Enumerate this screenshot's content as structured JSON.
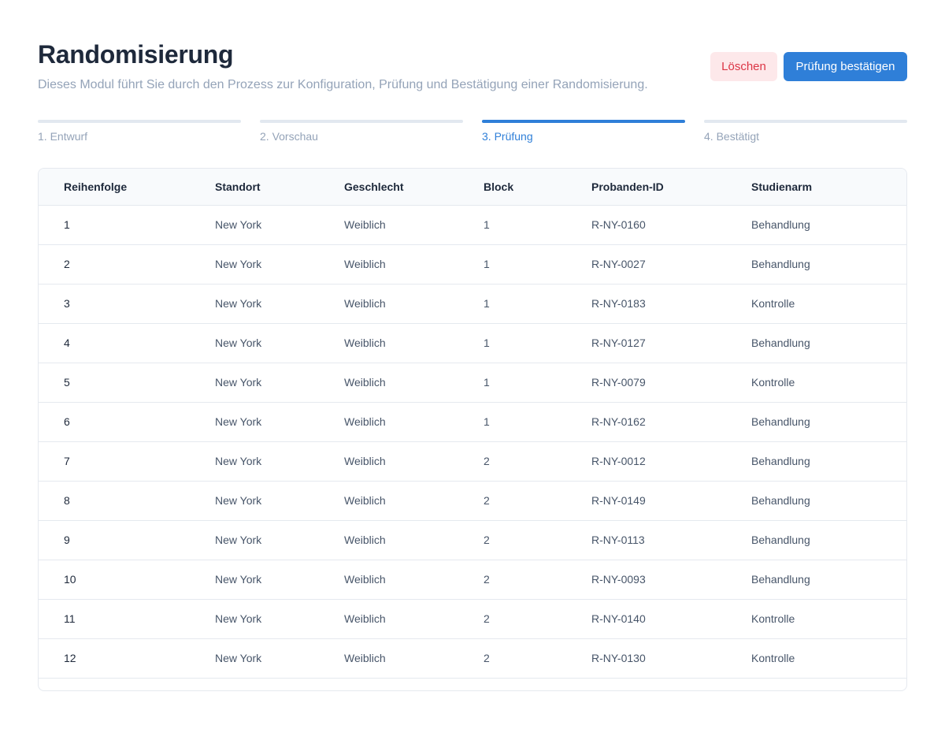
{
  "header": {
    "title": "Randomisierung",
    "subtitle": "Dieses Modul führt Sie durch den Prozess zur Konfiguration, Prüfung und Bestätigung einer Randomisierung."
  },
  "actions": {
    "delete_label": "Löschen",
    "confirm_label": "Prüfung bestätigen"
  },
  "colors": {
    "primary": "#2f7fd8",
    "danger": "#dc3545",
    "danger_bg": "#fde8ea"
  },
  "steps": [
    {
      "label": "1. Entwurf"
    },
    {
      "label": "2. Vorschau"
    },
    {
      "label": "3. Prüfung"
    },
    {
      "label": "4. Bestätigt"
    }
  ],
  "active_step": 3,
  "table": {
    "columns": [
      "Reihenfolge",
      "Standort",
      "Geschlecht",
      "Block",
      "Probanden-ID",
      "Studienarm"
    ],
    "rows": [
      [
        "1",
        "New York",
        "Weiblich",
        "1",
        "R-NY-0160",
        "Behandlung"
      ],
      [
        "2",
        "New York",
        "Weiblich",
        "1",
        "R-NY-0027",
        "Behandlung"
      ],
      [
        "3",
        "New York",
        "Weiblich",
        "1",
        "R-NY-0183",
        "Kontrolle"
      ],
      [
        "4",
        "New York",
        "Weiblich",
        "1",
        "R-NY-0127",
        "Behandlung"
      ],
      [
        "5",
        "New York",
        "Weiblich",
        "1",
        "R-NY-0079",
        "Kontrolle"
      ],
      [
        "6",
        "New York",
        "Weiblich",
        "1",
        "R-NY-0162",
        "Behandlung"
      ],
      [
        "7",
        "New York",
        "Weiblich",
        "2",
        "R-NY-0012",
        "Behandlung"
      ],
      [
        "8",
        "New York",
        "Weiblich",
        "2",
        "R-NY-0149",
        "Behandlung"
      ],
      [
        "9",
        "New York",
        "Weiblich",
        "2",
        "R-NY-0113",
        "Behandlung"
      ],
      [
        "10",
        "New York",
        "Weiblich",
        "2",
        "R-NY-0093",
        "Behandlung"
      ],
      [
        "11",
        "New York",
        "Weiblich",
        "2",
        "R-NY-0140",
        "Kontrolle"
      ],
      [
        "12",
        "New York",
        "Weiblich",
        "2",
        "R-NY-0130",
        "Kontrolle"
      ]
    ]
  }
}
